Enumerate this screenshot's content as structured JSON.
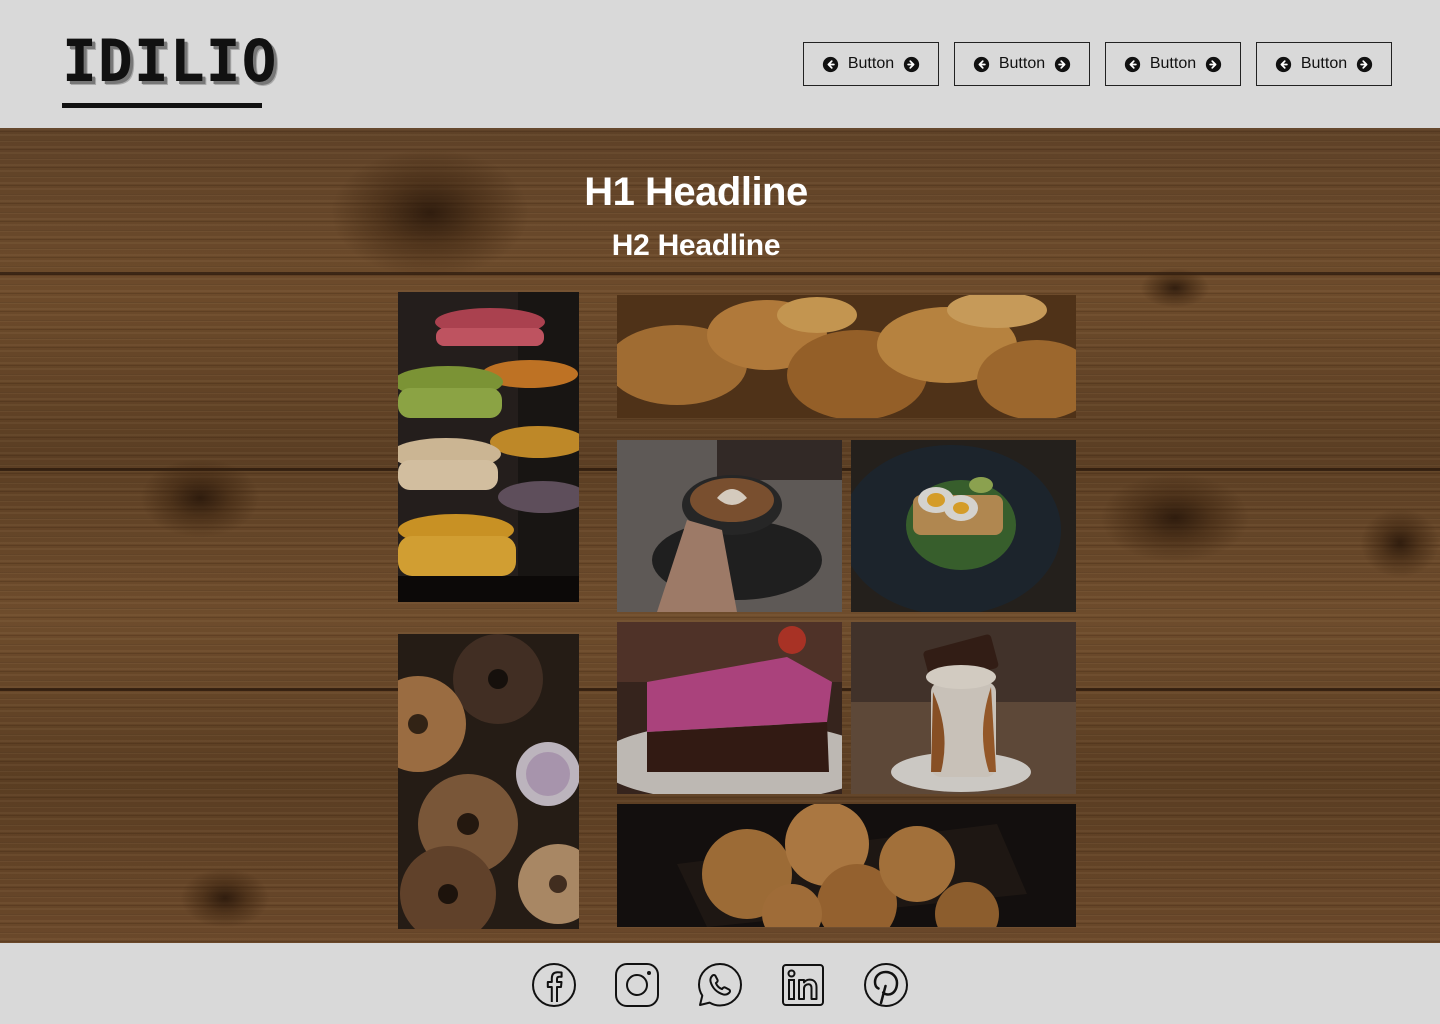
{
  "header": {
    "logo_text": "IDILIO",
    "nav": [
      {
        "label": "Button"
      },
      {
        "label": "Button"
      },
      {
        "label": "Button"
      },
      {
        "label": "Button"
      }
    ]
  },
  "hero": {
    "h1": "H1 Headline",
    "h2": "H2 Headline"
  },
  "gallery": [
    {
      "subject": "macarons"
    },
    {
      "subject": "bagels"
    },
    {
      "subject": "croissants"
    },
    {
      "subject": "latte-art-coffee"
    },
    {
      "subject": "egg-toast"
    },
    {
      "subject": "berry-cake"
    },
    {
      "subject": "chocolate-milkshake"
    },
    {
      "subject": "cookies"
    }
  ],
  "footer": {
    "social": [
      "facebook-icon",
      "instagram-icon",
      "whatsapp-icon",
      "linkedin-icon",
      "pinterest-icon"
    ]
  },
  "colors": {
    "header_bg": "#d9d9d9",
    "footer_bg": "#d9d9d9",
    "wood": "#6a482a",
    "text_on_hero": "#ffffff",
    "ink": "#111111"
  }
}
